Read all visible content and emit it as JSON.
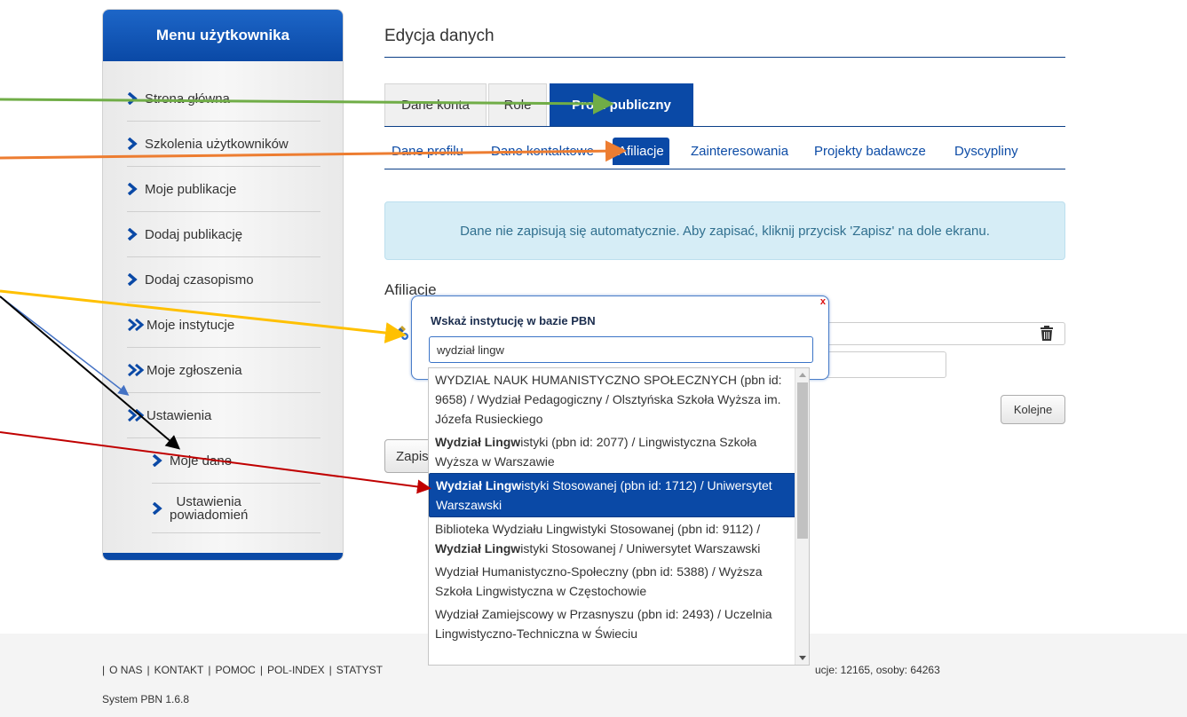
{
  "sidebar": {
    "title": "Menu użytkownika",
    "items": [
      {
        "label": "Strona główna"
      },
      {
        "label": "Szkolenia użytkowników"
      },
      {
        "label": "Moje publikacje"
      },
      {
        "label": "Dodaj publikację"
      },
      {
        "label": "Dodaj czasopismo"
      },
      {
        "label": "Moje instytucje"
      },
      {
        "label": "Moje zgłoszenia"
      },
      {
        "label": "Ustawienia"
      },
      {
        "label": "Moje dane"
      },
      {
        "label_line1": "Ustawienia",
        "label_line2": "powiadomień"
      }
    ]
  },
  "main": {
    "title": "Edycja danych",
    "tabs": [
      {
        "label": "Dane konta"
      },
      {
        "label": "Role"
      },
      {
        "label": "Profil publiczny"
      }
    ],
    "subtabs": [
      {
        "label": "Dane profilu"
      },
      {
        "label": "Dane kontaktowe"
      },
      {
        "label": "Afiliacje"
      },
      {
        "label": "Zainteresowania"
      },
      {
        "label": "Projekty badawcze"
      },
      {
        "label": "Dyscypliny"
      }
    ],
    "notice": "Dane nie zapisują się automatycznie. Aby zapisać, kliknij przycisk 'Zapisz' na dole ekranu.",
    "section_title": "Afiliacje",
    "next_button": "Kolejne",
    "save_button": "Zapisz"
  },
  "popup": {
    "title": "Wskaż instytucję w bazie PBN",
    "close": "x",
    "search_value": "wydział lingw"
  },
  "autocomplete": {
    "items": [
      {
        "bold": "",
        "text": "WYDZIAŁ NAUK HUMANISTYCZNO SPOŁECZNYCH (pbn id: 9658) / Wydział Pedagogiczny / Olsztyńska Szkoła Wyższa im. Józefa Rusieckiego"
      },
      {
        "bold": "Wydział Lingw",
        "text": "istyki (pbn id: 2077) / Lingwistyczna Szkoła Wyższa w Warszawie"
      },
      {
        "bold": "Wydział Lingw",
        "text": "istyki Stosowanej (pbn id: 1712) / Uniwersytet Warszawski"
      },
      {
        "pre": "Biblioteka Wydziału Lingwistyki Stosowanej (pbn id: 9112) / ",
        "bold": "Wydział Lingw",
        "text": "istyki Stosowanej / Uniwersytet Warszawski"
      },
      {
        "bold": "",
        "text": "Wydział Humanistyczno-Społeczny (pbn id: 5388) / Wyższa Szkoła Lingwistyczna w Częstochowie"
      },
      {
        "bold": "",
        "text": "Wydział Zamiejscowy w Przasnyszu (pbn id: 2493) / Uczelnia Lingwistyczno-Techniczna w Świeciu"
      }
    ],
    "selected_index": 2
  },
  "footer": {
    "links": [
      "O NAS",
      "KONTAKT",
      "POMOC",
      "POL-INDEX",
      "STATYST"
    ],
    "stats": "ucje: 12165, osoby: 64263",
    "version": "System PBN 1.6.8"
  },
  "colors": {
    "brand_blue": "#0a49a6",
    "arrow_green": "#70ad47",
    "arrow_orange": "#ed7d31",
    "arrow_yellow": "#ffc000",
    "arrow_blue": "#4472c4",
    "arrow_black": "#000000",
    "arrow_red": "#c00000"
  }
}
